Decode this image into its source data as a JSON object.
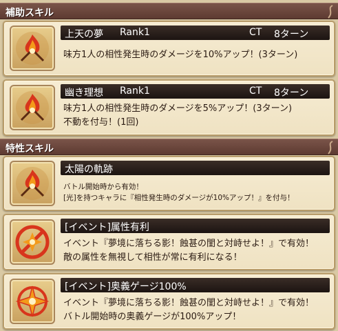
{
  "sections": {
    "support_title": "補助スキル",
    "trait_title": "特性スキル"
  },
  "support_skills": [
    {
      "name": "上天の夢",
      "rank": "Rank1",
      "ct_label": "CT",
      "ct_value": "8ターン",
      "icon": "flame-sword-icon",
      "lines": [
        "味方1人の相性発生時のダメージを10%アップ！(3ターン)"
      ]
    },
    {
      "name": "幽き理想",
      "rank": "Rank1",
      "ct_label": "CT",
      "ct_value": "8ターン",
      "icon": "flame-sword-icon",
      "lines": [
        "味方1人の相性発生時のダメージを5%アップ！(3ターン)",
        "不動を付与！(1回)"
      ]
    }
  ],
  "trait_skills": [
    {
      "name": "太陽の軌跡",
      "icon": "flame-sword-icon",
      "lines": [
        "バトル開始時から有効！",
        "[光]を持つキャラに『相性発生時のダメージが10%アップ！』を付与！"
      ]
    },
    {
      "name": "[イベント]属性有利",
      "icon": "element-advantage-icon",
      "lines": [
        "イベント『夢境に落ちる影！蝕甚の閨と対峙せよ！』で有効！",
        "敵の属性を無視して相性が常に有利になる！"
      ]
    },
    {
      "name": "[イベント]奥義ゲージ100%",
      "icon": "ougi-gauge-icon",
      "lines": [
        "イベント『夢境に落ちる影！蝕甚の閨と対峙せよ！』で有効！",
        "バトル開始時の奥義ゲージが100%アップ！"
      ]
    }
  ],
  "colors": {
    "header_bg": "#6b463c",
    "card_bg": "#f3e8cc",
    "icon_red": "#d8351c",
    "icon_orange": "#f39a1a"
  }
}
